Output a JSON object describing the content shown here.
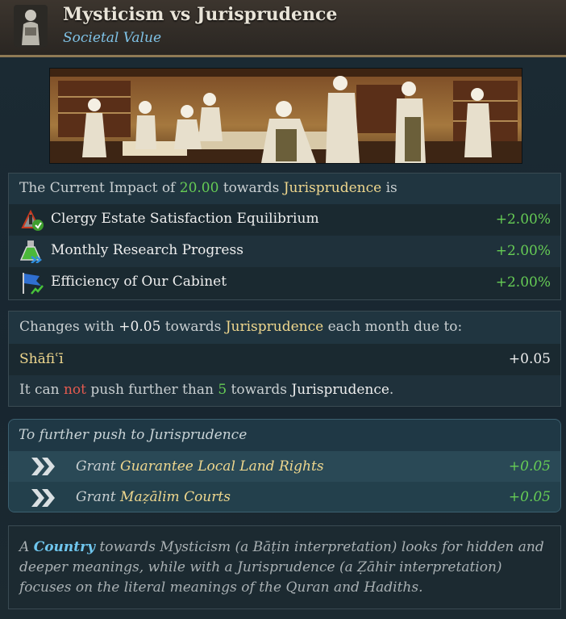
{
  "header": {
    "title": "Mysticism vs Jurisprudence",
    "subtitle": "Societal Value"
  },
  "impact": {
    "prefix": "The Current Impact of ",
    "value": "20.00",
    "middle": " towards ",
    "target": "Jurisprudence",
    "suffix": " is",
    "effects": [
      {
        "label": "Clergy Estate Satisfaction Equilibrium",
        "value": "+2.00%",
        "icon": "clergy-satisfaction-icon"
      },
      {
        "label": "Monthly Research Progress",
        "value": "+2.00%",
        "icon": "research-flask-icon"
      },
      {
        "label": "Efficiency of Our Cabinet",
        "value": "+2.00%",
        "icon": "cabinet-flag-icon"
      }
    ]
  },
  "changes": {
    "prefix": "Changes with ",
    "value": "+0.05",
    "middle": " towards ",
    "target": "Jurisprudence",
    "suffix": " each month due to:",
    "source_label": "Shāfiʿī",
    "source_value": "+0.05",
    "limit_prefix": "It can ",
    "limit_not": "not",
    "limit_middle": " push further than ",
    "limit_value": "5",
    "limit_towards": " towards ",
    "limit_target": "Jurisprudence",
    "limit_end": "."
  },
  "push": {
    "heading": "To further push to Jurisprudence",
    "items": [
      {
        "verb": "Grant ",
        "name": "Guarantee Local Land Rights",
        "value": "+0.05"
      },
      {
        "verb": "Grant ",
        "name": "Maẓālim Courts",
        "value": "+0.05"
      }
    ]
  },
  "description": {
    "a": "A ",
    "keyword": "Country",
    "rest": " towards Mysticism (a Bāṭin interpretation) looks for hidden and deeper meanings, while with a Jurisprudence (a Ẓāhir interpretation) focuses on the literal meanings of the Quran and Hadiths."
  },
  "colors": {
    "highlight": "#f0d88e",
    "positive": "#66cc55",
    "negative": "#e35a4f",
    "link": "#6fc6ee"
  }
}
